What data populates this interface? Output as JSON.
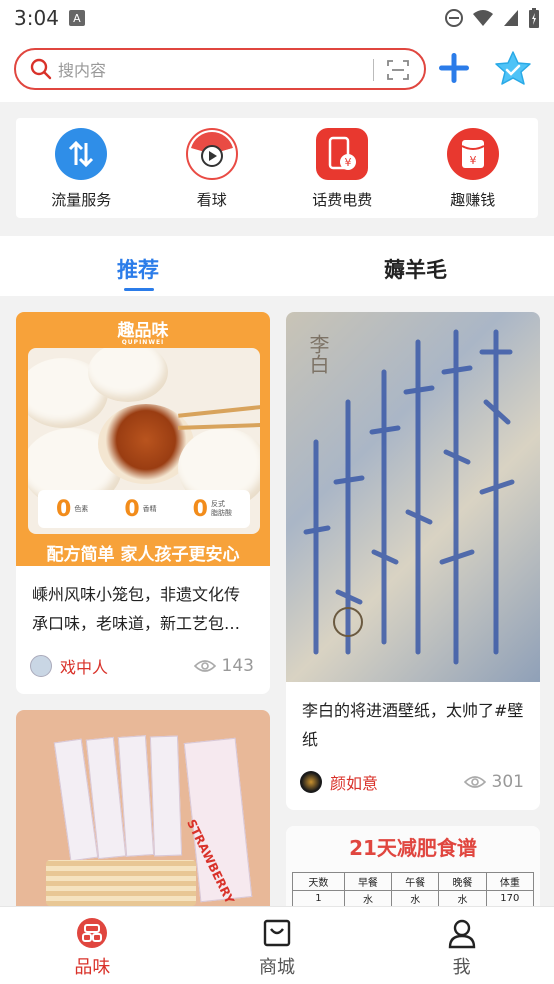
{
  "status_bar": {
    "time": "3:04",
    "sim_badge": "A"
  },
  "search": {
    "placeholder": "搜内容"
  },
  "quick_actions": [
    {
      "label": "流量服务",
      "icon": "data-transfer-icon",
      "color": "#2f8ee8"
    },
    {
      "label": "看球",
      "icon": "ball-play-icon",
      "color": "#e94b44"
    },
    {
      "label": "话费电费",
      "icon": "phone-bill-icon",
      "color": "#e8382f"
    },
    {
      "label": "趣赚钱",
      "icon": "red-envelope-icon",
      "color": "#e8382f"
    }
  ],
  "tabs": [
    {
      "label": "推荐",
      "active": true
    },
    {
      "label": "薅羊毛",
      "active": false
    }
  ],
  "feed": [
    {
      "image": {
        "brand": "趣品味",
        "brand_sub": "QUPINWEI",
        "stats": [
          "0",
          "0",
          "0"
        ],
        "stat_labels": [
          "色素",
          "香精",
          "反式\n脂肪酸"
        ],
        "tagline": "配方简单 家人孩子更安心"
      },
      "title": "嵊州风味小笼包，非遗文化传承口味，老味道，新工艺包…",
      "author": "戏中人",
      "views": "143"
    },
    {
      "image": {
        "caption": "李白"
      },
      "title": "李白的将进酒壁纸，太帅了#壁纸",
      "author": "颜如意",
      "views": "301"
    },
    {
      "image": {
        "caption": "STRAWBERRY"
      }
    },
    {
      "image": {
        "caption": "21天减肥食谱",
        "headers": [
          "天数",
          "早餐",
          "午餐",
          "晚餐",
          "体重"
        ],
        "row1": [
          "1",
          "水",
          "水",
          "水",
          "170"
        ]
      }
    }
  ],
  "bottom_nav": [
    {
      "label": "品味",
      "active": true
    },
    {
      "label": "商城",
      "active": false
    },
    {
      "label": "我",
      "active": false
    }
  ]
}
